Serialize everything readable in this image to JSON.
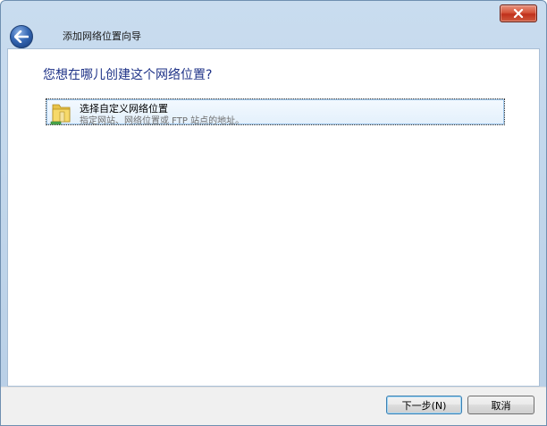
{
  "window": {
    "title": "添加网络位置向导"
  },
  "page": {
    "heading": "您想在哪儿创建这个网络位置?"
  },
  "option": {
    "title": "选择自定义网络位置",
    "description": "指定网站、网络位置或 FTP 站点的地址。",
    "icon": "folder-network-icon"
  },
  "buttons": {
    "next_label": "下一步(N)",
    "cancel_label": "取消"
  },
  "colors": {
    "heading": "#1e3287",
    "close_button": "#c0301b",
    "back_button": "#3567b3"
  }
}
